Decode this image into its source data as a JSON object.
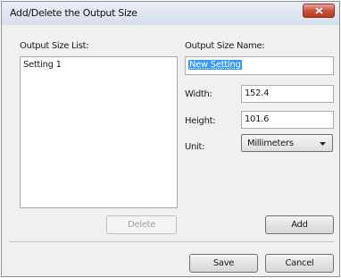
{
  "window": {
    "title": "Add/Delete the Output Size",
    "close_icon": "close-icon"
  },
  "list": {
    "label": "Output Size List:",
    "items": [
      "Setting 1"
    ]
  },
  "form": {
    "name_label": "Output Size Name:",
    "name_value": "New Setting",
    "width_label": "Width:",
    "width_value": "152.4",
    "height_label": "Height:",
    "height_value": "101.6",
    "unit_label": "Unit:",
    "unit_value": "Millimeters"
  },
  "buttons": {
    "delete": "Delete",
    "add": "Add",
    "save": "Save",
    "cancel": "Cancel"
  },
  "colors": {
    "selection": "#3399ff",
    "close_button": "#c8523f",
    "dialog_background": "#f0f0f0"
  }
}
